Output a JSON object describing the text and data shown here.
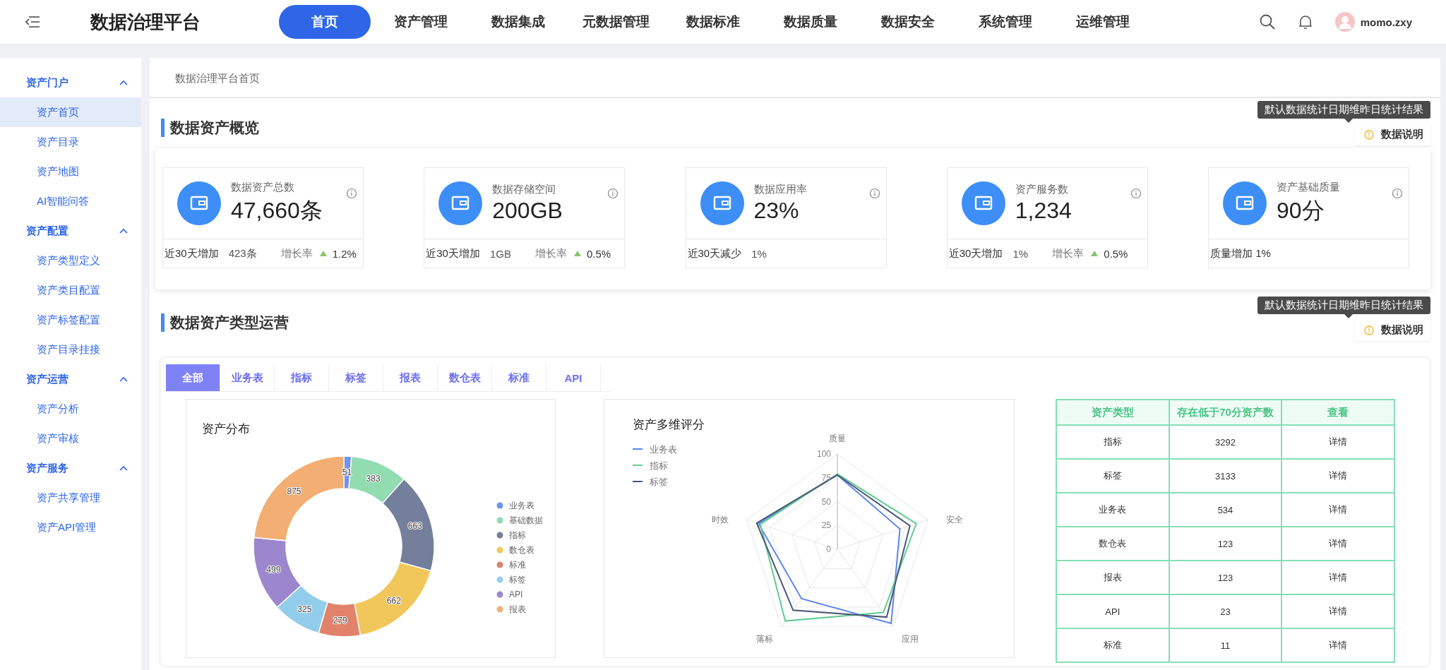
{
  "header": {
    "title": "数据治理平台",
    "nav": [
      {
        "label": "首页",
        "selected": true
      },
      {
        "label": "资产管理",
        "selected": false
      },
      {
        "label": "数据集成",
        "selected": false
      },
      {
        "label": "元数据管理",
        "selected": false
      },
      {
        "label": "数据标准",
        "selected": false
      },
      {
        "label": "数据质量",
        "selected": false
      },
      {
        "label": "数据安全",
        "selected": false
      },
      {
        "label": "系统管理",
        "selected": false
      },
      {
        "label": "运维管理",
        "selected": false
      }
    ],
    "username": "momo.zxy"
  },
  "sidebar": {
    "groups": [
      {
        "label": "资产门户",
        "expanded": true,
        "children": [
          {
            "label": "资产首页",
            "selected": true
          },
          {
            "label": "资产目录",
            "selected": false
          },
          {
            "label": "资产地图",
            "selected": false
          },
          {
            "label": "AI智能问答",
            "selected": false
          }
        ]
      },
      {
        "label": "资产配置",
        "expanded": true,
        "children": [
          {
            "label": "资产类型定义",
            "selected": false
          },
          {
            "label": "资产类目配置",
            "selected": false
          },
          {
            "label": "资产标签配置",
            "selected": false
          },
          {
            "label": "资产目录挂接",
            "selected": false
          }
        ]
      },
      {
        "label": "资产运营",
        "expanded": true,
        "children": [
          {
            "label": "资产分析",
            "selected": false
          },
          {
            "label": "资产审核",
            "selected": false
          }
        ]
      },
      {
        "label": "资产服务",
        "expanded": true,
        "children": [
          {
            "label": "资产共享管理",
            "selected": false
          },
          {
            "label": "资产API管理",
            "selected": false
          }
        ]
      }
    ]
  },
  "breadcrumb": "数据治理平台首页",
  "overview": {
    "title": "数据资产概览",
    "tooltip": "默认数据统计日期维昨日统计结果",
    "note": "数据说明",
    "cards": [
      {
        "title": "数据资产总数",
        "value": "47,660条",
        "footer": [
          {
            "kind": "label",
            "text": "近30天增加"
          },
          {
            "kind": "value",
            "text": "423条"
          },
          {
            "kind": "rate_label",
            "text": "增长率"
          },
          {
            "kind": "rate_up",
            "text": "1.2%"
          }
        ]
      },
      {
        "title": "数据存储空间",
        "value": "200GB",
        "footer": [
          {
            "kind": "label",
            "text": "近30天增加"
          },
          {
            "kind": "value",
            "text": "1GB"
          },
          {
            "kind": "rate_label",
            "text": "增长率"
          },
          {
            "kind": "rate_up",
            "text": "0.5%"
          }
        ]
      },
      {
        "title": "数据应用率",
        "value": "23%",
        "footer": [
          {
            "kind": "label",
            "text": "近30天减少"
          },
          {
            "kind": "value",
            "text": "1%"
          }
        ]
      },
      {
        "title": "资产服务数",
        "value": "1,234",
        "footer": [
          {
            "kind": "label",
            "text": "近30天增加"
          },
          {
            "kind": "value",
            "text": "1%"
          },
          {
            "kind": "rate_label",
            "text": "增长率"
          },
          {
            "kind": "rate_up",
            "text": "0.5%"
          }
        ]
      },
      {
        "title": "资产基础质量",
        "value": "90分",
        "footer": [
          {
            "kind": "label",
            "text": "质量增加 1%"
          }
        ]
      }
    ]
  },
  "operations": {
    "title": "数据资产类型运营",
    "tooltip": "默认数据统计日期维昨日统计结果",
    "note": "数据说明",
    "tabs": [
      {
        "label": "全部",
        "selected": true
      },
      {
        "label": "业务表",
        "selected": false
      },
      {
        "label": "指标",
        "selected": false
      },
      {
        "label": "标签",
        "selected": false
      },
      {
        "label": "报表",
        "selected": false
      },
      {
        "label": "数仓表",
        "selected": false
      },
      {
        "label": "标准",
        "selected": false
      },
      {
        "label": "API",
        "selected": false
      }
    ],
    "distribution": {
      "chart_data": {
        "type": "donut",
        "title": "资产分布",
        "categories": [
          "业务表",
          "基础数据",
          "指标",
          "数仓表",
          "标准",
          "标签",
          "API",
          "报表"
        ],
        "values": [
          51,
          383,
          663,
          662,
          279,
          325,
          499,
          875
        ],
        "legend": "right",
        "colors": [
          "#6f95f0",
          "#91dcb1",
          "#737f9b",
          "#f1c75b",
          "#e0836a",
          "#93cdec",
          "#9c87cf",
          "#f2ae73"
        ],
        "data_labels": true
      }
    },
    "scores": {
      "chart_data": {
        "type": "radar",
        "title": "资产多维评分",
        "legend": "top-left",
        "categories": [
          "质量",
          "安全",
          "应用",
          "落标",
          "时效"
        ],
        "ylim": [
          0,
          100
        ],
        "yticks": [
          0,
          25,
          50,
          75,
          100
        ],
        "series": [
          {
            "name": "业务表",
            "color": "#5b86f2",
            "values": [
              78,
              69,
              96,
              64,
              87
            ]
          },
          {
            "name": "指标",
            "color": "#62cc92",
            "values": [
              79,
              87,
              82,
              93,
              85
            ]
          },
          {
            "name": "标签",
            "color": "#4a5777",
            "values": [
              78,
              80,
              88,
              79,
              89
            ]
          }
        ]
      }
    },
    "table": {
      "columns": [
        "资产类型",
        "存在低于70分资产数",
        "查看"
      ],
      "rows": [
        [
          "指标",
          "3292",
          "详情"
        ],
        [
          "标签",
          "3133",
          "详情"
        ],
        [
          "业务表",
          "534",
          "详情"
        ],
        [
          "数仓表",
          "123",
          "详情"
        ],
        [
          "报表",
          "123",
          "详情"
        ],
        [
          "API",
          "23",
          "详情"
        ],
        [
          "标准",
          "11",
          "详情"
        ]
      ]
    }
  }
}
